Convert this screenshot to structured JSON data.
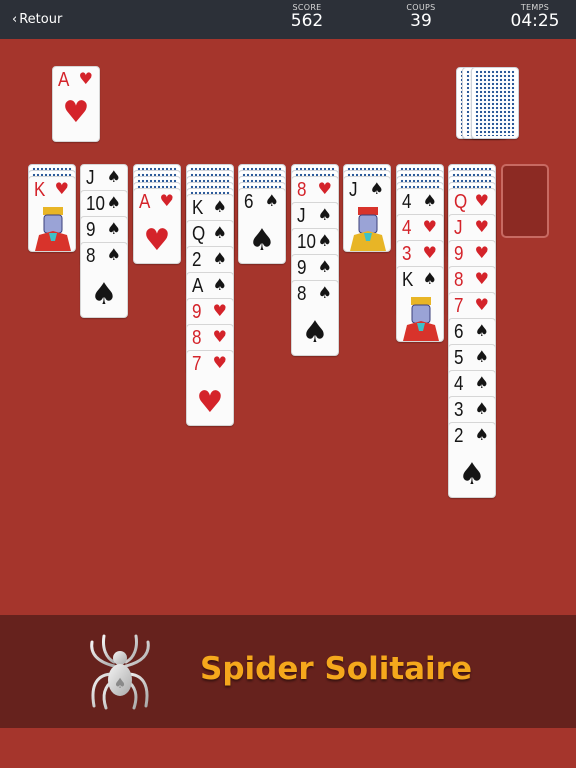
{
  "header": {
    "back_label": "Retour",
    "score_label": "SCORE",
    "score_value": "562",
    "moves_label": "COUPS",
    "moves_value": "39",
    "time_label": "TEMPS",
    "time_value": "04:25"
  },
  "colors": {
    "felt": "#a5352c",
    "header": "#2c3038",
    "banner": "#66221d",
    "title": "#f5a81c",
    "red_suit": "#d4232a",
    "card_back_pattern": "#2d5b9a"
  },
  "foundation": {
    "rank": "A",
    "suit": "♥",
    "suit_name": "hearts",
    "color": "red"
  },
  "stock": {
    "piles": 3
  },
  "tableau": [
    {
      "backs": 2,
      "cards": [
        {
          "rank": "K",
          "suit": "♥",
          "color": "red",
          "court": "king"
        }
      ]
    },
    {
      "backs": 0,
      "cards": [
        {
          "rank": "J",
          "suit": "♠",
          "color": "blk"
        },
        {
          "rank": "10",
          "suit": "♠",
          "color": "blk"
        },
        {
          "rank": "9",
          "suit": "♠",
          "color": "blk"
        },
        {
          "rank": "8",
          "suit": "♠",
          "color": "blk"
        }
      ]
    },
    {
      "backs": 4,
      "cards": [
        {
          "rank": "A",
          "suit": "♥",
          "color": "red"
        }
      ]
    },
    {
      "backs": 5,
      "cards": [
        {
          "rank": "K",
          "suit": "♠",
          "color": "blk"
        },
        {
          "rank": "Q",
          "suit": "♠",
          "color": "blk"
        },
        {
          "rank": "2",
          "suit": "♠",
          "color": "blk"
        },
        {
          "rank": "A",
          "suit": "♠",
          "color": "blk"
        },
        {
          "rank": "9",
          "suit": "♥",
          "color": "red"
        },
        {
          "rank": "8",
          "suit": "♥",
          "color": "red"
        },
        {
          "rank": "7",
          "suit": "♥",
          "color": "red"
        }
      ]
    },
    {
      "backs": 4,
      "cards": [
        {
          "rank": "6",
          "suit": "♠",
          "color": "blk"
        }
      ]
    },
    {
      "backs": 2,
      "cards": [
        {
          "rank": "8",
          "suit": "♥",
          "color": "red"
        },
        {
          "rank": "J",
          "suit": "♠",
          "color": "blk"
        },
        {
          "rank": "10",
          "suit": "♠",
          "color": "blk"
        },
        {
          "rank": "9",
          "suit": "♠",
          "color": "blk"
        },
        {
          "rank": "8",
          "suit": "♠",
          "color": "blk"
        }
      ]
    },
    {
      "backs": 2,
      "cards": [
        {
          "rank": "J",
          "suit": "♠",
          "color": "blk",
          "court": "jack"
        }
      ]
    },
    {
      "backs": 4,
      "cards": [
        {
          "rank": "4",
          "suit": "♠",
          "color": "blk"
        },
        {
          "rank": "4",
          "suit": "♥",
          "color": "red"
        },
        {
          "rank": "3",
          "suit": "♥",
          "color": "red"
        },
        {
          "rank": "K",
          "suit": "♠",
          "color": "blk",
          "court": "king"
        }
      ]
    },
    {
      "backs": 4,
      "cards": [
        {
          "rank": "Q",
          "suit": "♥",
          "color": "red"
        },
        {
          "rank": "J",
          "suit": "♥",
          "color": "red"
        },
        {
          "rank": "9",
          "suit": "♥",
          "color": "red"
        },
        {
          "rank": "8",
          "suit": "♥",
          "color": "red"
        },
        {
          "rank": "7",
          "suit": "♥",
          "color": "red"
        },
        {
          "rank": "6",
          "suit": "♠",
          "color": "blk"
        },
        {
          "rank": "5",
          "suit": "♠",
          "color": "blk"
        },
        {
          "rank": "4",
          "suit": "♠",
          "color": "blk"
        },
        {
          "rank": "3",
          "suit": "♠",
          "color": "blk"
        },
        {
          "rank": "2",
          "suit": "♠",
          "color": "blk"
        }
      ]
    },
    {
      "backs": 0,
      "cards": [],
      "empty": true
    }
  ],
  "banner": {
    "title": "Spider Solitaire",
    "logo_icon": "spider-icon"
  }
}
